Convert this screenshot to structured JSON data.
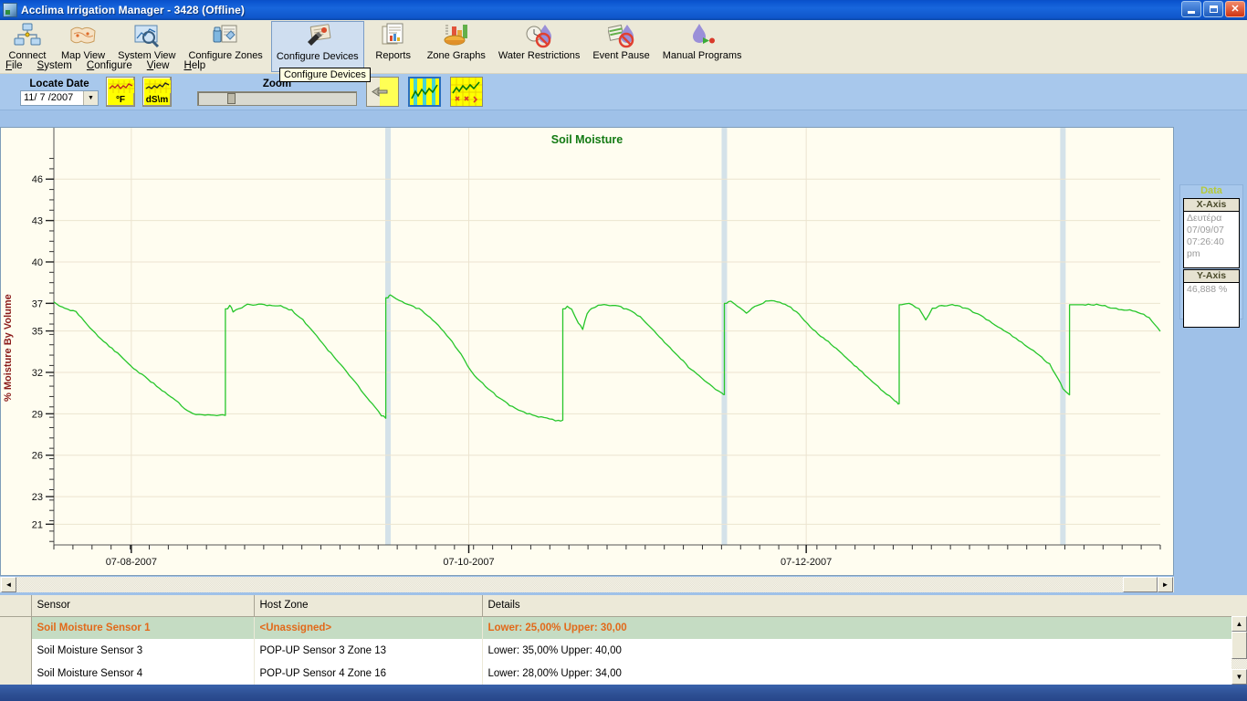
{
  "window": {
    "title": "Acclima Irrigation Manager - 3428 (Offline)",
    "icon": "app-icon",
    "minimize": "minimize",
    "maximize": "maximize",
    "close": "close"
  },
  "toolbar": {
    "buttons": [
      {
        "label": "Connect",
        "icon": "connect-icon"
      },
      {
        "label": "Map View",
        "icon": "map-view-icon"
      },
      {
        "label": "System View",
        "icon": "system-view-icon"
      },
      {
        "label": "Configure Zones",
        "icon": "configure-zones-icon"
      },
      {
        "label": "Configure Devices",
        "icon": "configure-devices-icon"
      },
      {
        "label": "Reports",
        "icon": "reports-icon"
      },
      {
        "label": "Zone Graphs",
        "icon": "zone-graphs-icon"
      },
      {
        "label": "Water Restrictions",
        "icon": "water-restrictions-icon"
      },
      {
        "label": "Event Pause",
        "icon": "event-pause-icon"
      },
      {
        "label": "Manual Programs",
        "icon": "manual-programs-icon"
      }
    ],
    "tooltip": "Configure Devices",
    "selected_index": 4
  },
  "menu": {
    "items": [
      "File",
      "System",
      "Configure",
      "View",
      "Help"
    ]
  },
  "controls": {
    "locate_date_label": "Locate Date",
    "locate_date_value": "11/ 7 /2007",
    "dropdown_arrow": "▼",
    "unit_buttons": [
      {
        "label": "°F",
        "name": "temperature-unit-button"
      },
      {
        "label": "dS\\m",
        "name": "conductivity-unit-button"
      }
    ],
    "zoom_label": "Zoom",
    "zoom_value": 18,
    "graph_buttons": [
      {
        "name": "pan-left-button"
      },
      {
        "name": "show-events-button",
        "selected": true
      },
      {
        "name": "show-markers-button",
        "selected": false
      }
    ]
  },
  "chart_data": {
    "type": "line",
    "title": "Soil Moisture",
    "xlabel": "",
    "ylabel": "% Moisture By Volume",
    "ylim": [
      19.5,
      48
    ],
    "ytick_labels": [
      "46",
      "43",
      "40",
      "37",
      "35",
      "32",
      "29",
      "26",
      "23",
      "21"
    ],
    "ytick_values": [
      46,
      43,
      40,
      37,
      35,
      32,
      29,
      26,
      23,
      21
    ],
    "xtick_labels": [
      "07-08-2007",
      "07-10-2007",
      "07-12-2007"
    ],
    "xtick_positions": [
      0.07,
      0.375,
      0.68
    ],
    "grid": true,
    "line_color": "#27c62b",
    "plot_bg": "#fffdf0",
    "event_bands": [
      0.302,
      0.606,
      0.912
    ],
    "series": [
      {
        "name": "Soil Moisture Sensor 1",
        "x": [
          0.0,
          0.01,
          0.02,
          0.03,
          0.04,
          0.05,
          0.06,
          0.072,
          0.085,
          0.098,
          0.11,
          0.118,
          0.126,
          0.134,
          0.142,
          0.15,
          0.155,
          0.157,
          0.159,
          0.162,
          0.175,
          0.19,
          0.205,
          0.215,
          0.225,
          0.235,
          0.248,
          0.262,
          0.275,
          0.288,
          0.296,
          0.3,
          0.302,
          0.304,
          0.307,
          0.312,
          0.32,
          0.33,
          0.34,
          0.35,
          0.36,
          0.368,
          0.374,
          0.38,
          0.39,
          0.4,
          0.412,
          0.425,
          0.438,
          0.448,
          0.456,
          0.46,
          0.462,
          0.464,
          0.468,
          0.474,
          0.478,
          0.482,
          0.486,
          0.492,
          0.5,
          0.51,
          0.52,
          0.53,
          0.54,
          0.552,
          0.564,
          0.576,
          0.588,
          0.598,
          0.604,
          0.606,
          0.608,
          0.612,
          0.618,
          0.626,
          0.636,
          0.646,
          0.656,
          0.666,
          0.676,
          0.686,
          0.7,
          0.714,
          0.728,
          0.74,
          0.75,
          0.758,
          0.762,
          0.764,
          0.766,
          0.77,
          0.776,
          0.782,
          0.788,
          0.794,
          0.8,
          0.812,
          0.826,
          0.84,
          0.856,
          0.872,
          0.888,
          0.9,
          0.908,
          0.912,
          0.918,
          0.93,
          0.945,
          0.96,
          0.975,
          0.99,
          1.0
        ],
        "y": [
          37.1,
          36.6,
          36.4,
          35.5,
          34.6,
          33.9,
          33.2,
          32.3,
          31.5,
          30.7,
          30.0,
          29.4,
          29.0,
          28.9,
          28.9,
          28.9,
          28.9,
          36.6,
          36.9,
          36.4,
          36.9,
          36.9,
          36.8,
          36.5,
          35.8,
          34.9,
          33.6,
          32.3,
          31.0,
          29.7,
          28.9,
          28.7,
          37.4,
          37.6,
          37.5,
          37.2,
          36.9,
          36.6,
          36.0,
          35.2,
          34.2,
          33.3,
          32.5,
          31.8,
          31.0,
          30.3,
          29.6,
          29.1,
          28.8,
          28.6,
          28.5,
          28.5,
          36.6,
          36.8,
          36.6,
          35.6,
          35.1,
          36.3,
          36.6,
          36.9,
          36.9,
          36.8,
          36.5,
          36.0,
          35.2,
          34.2,
          33.2,
          32.2,
          31.4,
          30.8,
          30.5,
          30.4,
          37.0,
          37.2,
          36.8,
          36.3,
          36.9,
          37.2,
          37.1,
          36.7,
          36.0,
          35.1,
          34.2,
          33.2,
          32.2,
          31.3,
          30.6,
          30.1,
          29.8,
          29.7,
          36.9,
          37.0,
          36.9,
          36.6,
          35.8,
          36.6,
          36.8,
          36.9,
          36.6,
          36.0,
          35.2,
          34.3,
          33.4,
          32.6,
          31.5,
          30.8,
          30.4,
          36.9,
          36.9,
          36.6,
          36.5,
          36.0,
          35.0,
          34.0,
          33.0,
          32.3
        ]
      }
    ]
  },
  "data_panel": {
    "title": "Data",
    "x_axis": {
      "header": "X-Axis",
      "lines": [
        "Δευτέρα",
        "07/09/07",
        "07:26:40 pm"
      ]
    },
    "y_axis": {
      "header": "Y-Axis",
      "lines": [
        "46,888 %"
      ]
    }
  },
  "table": {
    "columns": [
      "Sensor",
      "Host Zone",
      "Details"
    ],
    "rows": [
      {
        "sensor": "Soil Moisture Sensor 1",
        "host_zone": "<Unassigned>",
        "details": "Lower: 25,00% Upper: 30,00",
        "selected": true
      },
      {
        "sensor": "Soil Moisture Sensor 3",
        "host_zone": "POP-UP Sensor 3 Zone 13",
        "details": "Lower: 35,00% Upper: 40,00",
        "selected": false
      },
      {
        "sensor": "Soil Moisture Sensor 4",
        "host_zone": "POP-UP Sensor 4 Zone 16",
        "details": "Lower: 28,00% Upper: 34,00",
        "selected": false
      }
    ]
  },
  "scrollbars": {
    "left_arrow": "◄",
    "right_arrow": "►",
    "up_arrow": "▲",
    "down_arrow": "▼"
  }
}
